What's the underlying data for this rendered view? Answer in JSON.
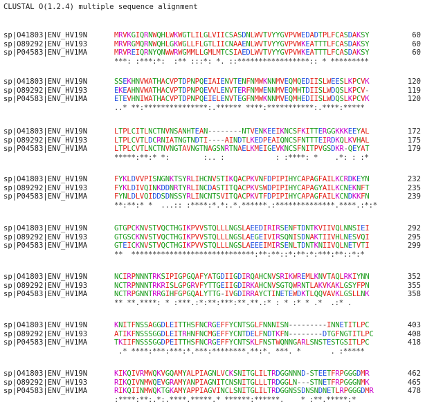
{
  "title": "CLUSTAL O(1.2.4) multiple sequence alignment",
  "colors": {
    "hydrophobic": "#e2231a",
    "acidic": "#1f4fe0",
    "basic": "#cc00cc",
    "polar": "#1a9a1a",
    "other": "#555555"
  },
  "blocks": [
    {
      "rows": [
        {
          "name": "sp|O41803|ENV_HV19N",
          "seq": "MRVKGIQRNWQHLWKWGTLILGLVIICSASDNLWVTVYYGVPVWEDADTPLFCASDAKSY",
          "num": "60"
        },
        {
          "name": "sp|O89292|ENV_HV193",
          "seq": "MRVRGMQRNWQHLGKWGLLFLGTLIICNAAENLWVTVYYGVPVWKEATTTLFCASDAKSY",
          "num": "60"
        },
        {
          "name": "sp|P04583|ENV_HV1MA",
          "seq": "MRVREIQRNYQNWWRWGMMLLGMLMTCSIAEDLWVTVYYGVPVWKEATTTLFCASDAKSY",
          "num": "60"
        }
      ],
      "consensus": "***: :***:*:  :** :::*: *. ::*****************:: * *********"
    },
    {
      "rows": [
        {
          "name": "sp|O41803|ENV_HV19N",
          "seq": "SSEKHNVWATHACVPTDPNPQEIAIENVTENFNMWKNNMVEQMQEDIISLWEESLKPCVK",
          "num": "120"
        },
        {
          "name": "sp|O89292|ENV_HV193",
          "seq": "EKEAHNVWATHACVPTDPNPQEVVLENVTERFNMWENNMVEQMHTDIISLWDQSLKPCV-",
          "num": "119"
        },
        {
          "name": "sp|P04583|ENV_HV1MA",
          "seq": "ETEVHNIWATHACVPTDPNPQEIELENVTEGFNMWKNNMVEQMHEDIISLWDQSLKPCVK",
          "num": "120"
        }
      ],
      "consensus": "..* **:***************:.****** ****:***********:.****:*****"
    },
    {
      "rows": [
        {
          "name": "sp|O41803|ENV_HV19N",
          "seq": "LTPLCITLNCTNVNSANHTEAN--------NTVENKEEIKNCSFKITTERGGKKKEEYAL",
          "num": "172"
        },
        {
          "name": "sp|O89292|ENV_HV193",
          "seq": "LTPLCVTLDCRNIATNGTNDTI----AINDTLKEDPEAIQNCSFNTTTEIRDKQLKVHAL",
          "num": "175"
        },
        {
          "name": "sp|P04583|ENV_HV1MA",
          "seq": "LTPLCVTLNCTNVNGTAVNGTNAGSNRTNAELKMEIGEVKNCSFNITPVGSDKR-QEYAT",
          "num": "179"
        }
      ],
      "consensus": "*****:**:* *:        :.. :            : :****: *    .*: : :*"
    },
    {
      "rows": [
        {
          "name": "sp|O41803|ENV_HV19N",
          "seq": "FYKLDVVPISNGNKTSYRLIHCNVSTIKQACPKVNFDPIPIHYCAPAGFAILKCRDKEYN",
          "num": "232"
        },
        {
          "name": "sp|O89292|ENV_HV193",
          "seq": "FYKLDIVQINKDDNRTYRLINCDASTITQACPKVSWDPIPIHYCAPAGYAILKCNEKNFT",
          "num": "235"
        },
        {
          "name": "sp|P04583|ENV_HV1MA",
          "seq": "FYNLDLVQIDDSDNSSYRLINCNTSVITQACPKVTFDPIPIHYCAPAGFAILKCNDKKFN",
          "num": "239"
        }
      ],
      "consensus": "**:**:* *  ...:: :****:*.*:.*.******.:**************.****.:*:*"
    },
    {
      "rows": [
        {
          "name": "sp|O41803|ENV_HV19N",
          "seq": "GTGPCKNVSTVQCTHGIKPVVSTQLLLNGSLAEEDIRIRSENFTDNTKVIIVQLNNSIEI",
          "num": "292"
        },
        {
          "name": "sp|O89292|ENV_HV193",
          "seq": "GTGSCKNVSTVQCTHGIKPVVSTQLLLNGSLAEGEIVIRSQNISDNAKTIIVHLNESVQI",
          "num": "295"
        },
        {
          "name": "sp|P04583|ENV_HV1MA",
          "seq": "GTEICKNVSTVQCTHGIKPVVSTQLLLNGSLAEEEIMIRSENLTDNTKNIIVQLNETVTI",
          "num": "299"
        }
      ],
      "consensus": "**  *****************************:**:**::*:**:*:***:**::*:*"
    },
    {
      "rows": [
        {
          "name": "sp|O41803|ENV_HV19N",
          "seq": "NCIRPNNNTRKSIPIGPGQAFYATGDIIGDIRQAHCNVSRIKWREMLKNVTAQLRKIYNN",
          "num": "352"
        },
        {
          "name": "sp|O89292|ENV_HV193",
          "seq": "NCTRPNNNTRKRISLGPGRVFYTTGEIIGDIRKAHCNVSGTQWRNTLAKVKAKLGSYFPN",
          "num": "355"
        },
        {
          "name": "sp|P04583|ENV_HV1MA",
          "seq": "NCTRPGNNTRRGIHFGPGQALYTTG-IVGDIRRAYCTINETEWDKTLQQVAVKLGSLLNK",
          "num": "358"
        }
      ],
      "consensus": "** **.****: * :***.:*:**:***:**.**.:* : * :* * .*  .:* ."
    },
    {
      "rows": [
        {
          "name": "sp|O41803|ENV_HV19N",
          "seq": "KNITFNSSAGGDLEITTHSFNCRGEFFYCNTSGLFNNNISN---------INNETITLPC",
          "num": "403"
        },
        {
          "name": "sp|O89292|ENV_HV193",
          "seq": "ATIKFNSSSGGDLEITRHNFNCMGEFFYCNTDELFNDTKFN--------DTGFNGTITLPC",
          "num": "408"
        },
        {
          "name": "sp|P04583|ENV_HV1MA",
          "seq": "TKIIFNSSSGGDPEITTHSFNCRGEFFYCNTSKLFNSTWQNNGARLSNSTESTGSITLPC",
          "num": "418"
        }
      ],
      "consensus": " .* ****:***:***:*.***:********.**:*. ***. *       . :*****"
    },
    {
      "rows": [
        {
          "name": "sp|O41803|ENV_HV19N",
          "seq": "KIKQIVRMWQKVGQAMYALPIAGNLVCKSNITGLILTRDGGNNND-STEETFRPGGGDMR",
          "num": "462"
        },
        {
          "name": "sp|O89292|ENV_HV193",
          "seq": "RIKQIVNMWQEVGRAMYANPIAGNITCNSNITGLLLTRDGGLN---STNETFRPGGGNMK",
          "num": "465"
        },
        {
          "name": "sp|P04583|ENV_HV1MA",
          "seq": "RIKQIINMWQKTGKAMYAPPIAGVINCLSNITGLILTRDGGNSSDNSNDNETLRPGGGDMR",
          "num": "478"
        }
      ],
      "consensus": ":****:**:.*:.****.*****.* ******:******.    * :**.*****:*"
    }
  ]
}
